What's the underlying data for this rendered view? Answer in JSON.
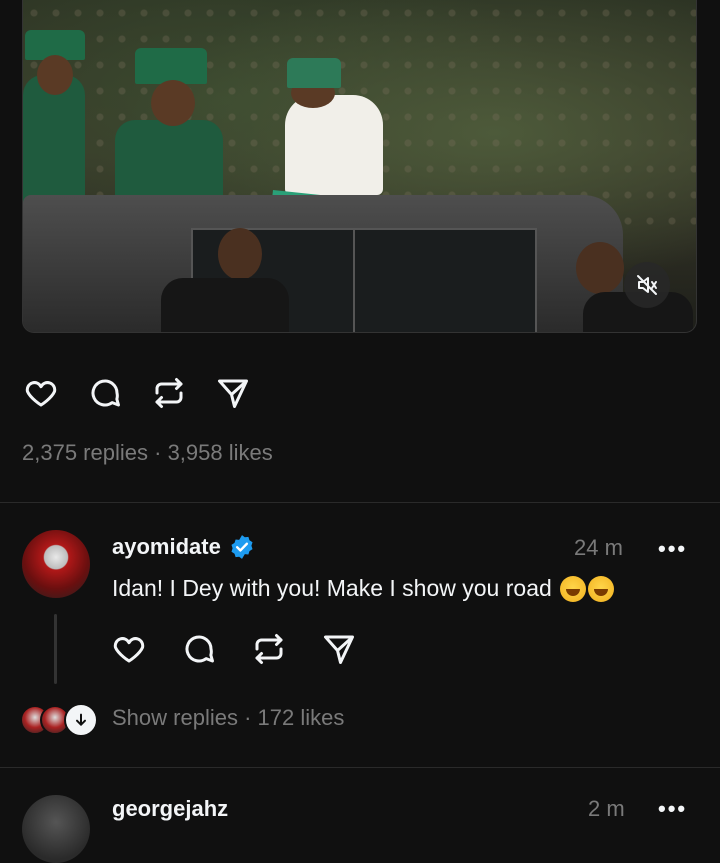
{
  "post": {
    "replies_count": "2,375 replies",
    "separator": "·",
    "likes_count": "3,958 likes"
  },
  "actions": {
    "like_icon": "heart-icon",
    "reply_icon": "comment-icon",
    "repost_icon": "repost-icon",
    "share_icon": "send-icon"
  },
  "comments": [
    {
      "username": "ayomidate",
      "verified": true,
      "time": "24 m",
      "text": "Idan! I Dey with you! Make I show you road",
      "emojis": [
        "grinning-sweat-emoji",
        "grinning-sweat-emoji"
      ],
      "show_replies": "Show replies",
      "likes": "172 likes"
    },
    {
      "username": "georgejahz",
      "time": "2 m"
    }
  ],
  "colors": {
    "background": "#101010",
    "text": "#f3f5f7",
    "muted": "#7a7a7a",
    "verified": "#1d9bf0"
  }
}
